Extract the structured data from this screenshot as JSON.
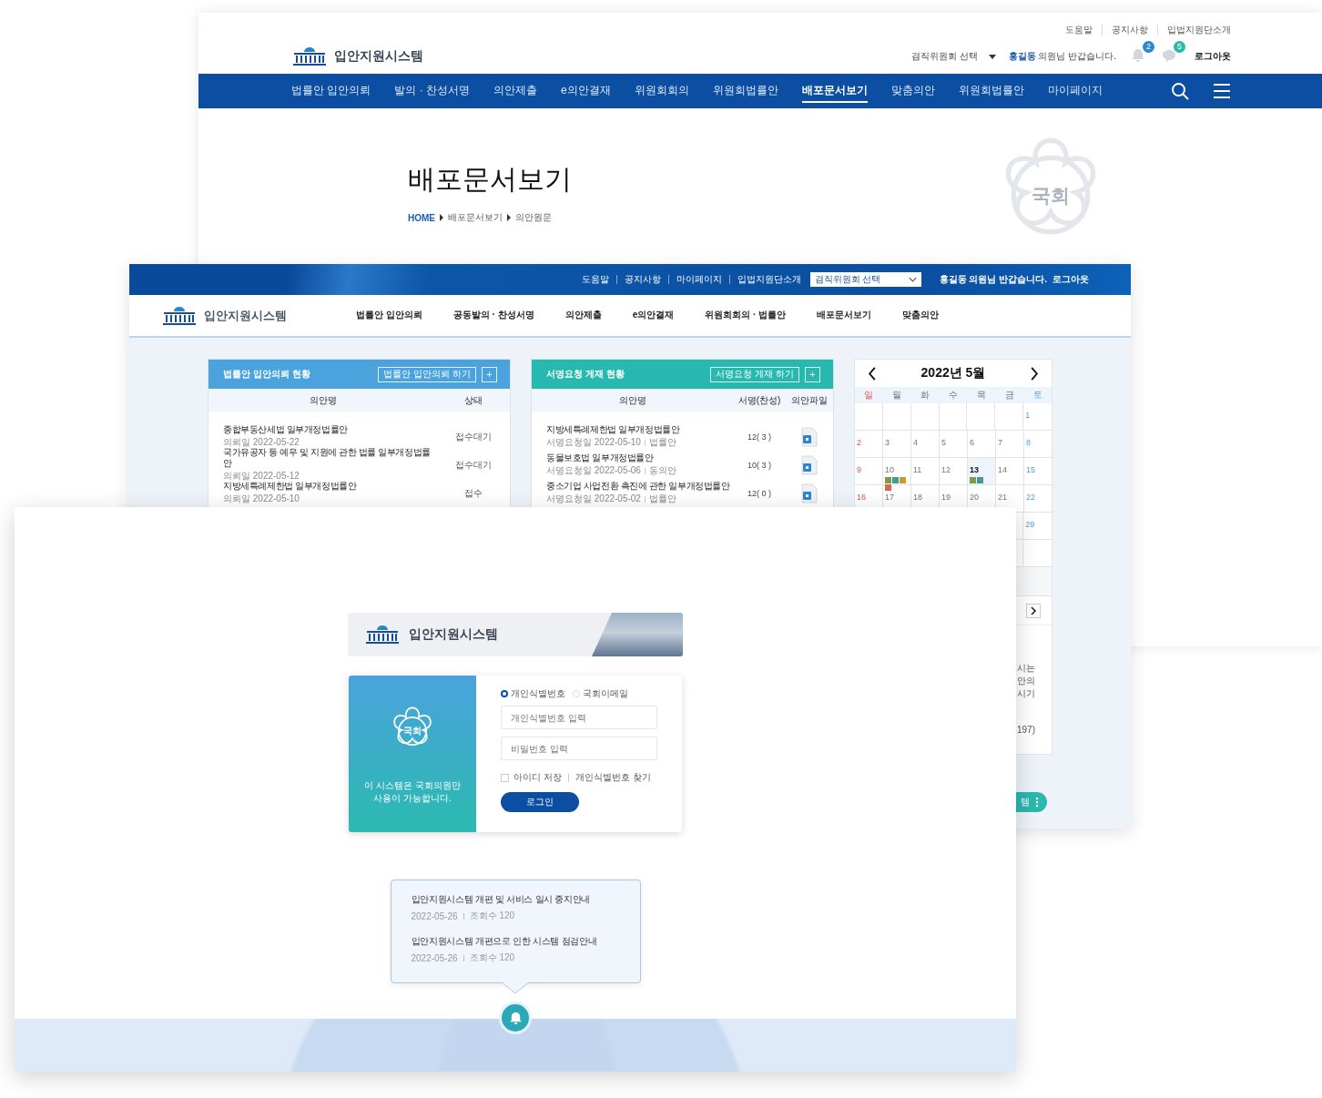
{
  "back_window": {
    "utility_links": [
      "도움말",
      "공지사항",
      "입법지원단소개"
    ],
    "logo_text": "입안지원시스템",
    "committee_select": "겸직위원회 선택",
    "user_name": "홍길동",
    "greeting": "의원님 반갑습니다.",
    "notifications": [
      {
        "kind": "bell",
        "count": "2"
      },
      {
        "kind": "chat",
        "count": "5"
      }
    ],
    "logout": "로그아웃",
    "nav": [
      {
        "label": "법률안 입안의뢰",
        "selected": false
      },
      {
        "label": "발의 · 찬성서명",
        "selected": false
      },
      {
        "label": "의안제출",
        "selected": false
      },
      {
        "label": "e의안결재",
        "selected": false
      },
      {
        "label": "위원회회의",
        "selected": false
      },
      {
        "label": "위원회법률안",
        "selected": false
      },
      {
        "label": "배포문서보기",
        "selected": true
      },
      {
        "label": "맞춤의안",
        "selected": false
      },
      {
        "label": "위원회법률안",
        "selected": false
      },
      {
        "label": "마이페이지",
        "selected": false
      }
    ],
    "page_title": "배포문서보기",
    "breadcrumb": [
      "HOME",
      "배포문서보기",
      "의안원문"
    ],
    "emblem_text": "국회"
  },
  "middle_window": {
    "utility_links": [
      "도움말",
      "공지사항",
      "마이페이지",
      "입법지원단소개"
    ],
    "committee_select": "겸직위원회 선택",
    "user_name": "홍길동",
    "greeting": "의원님 반갑습니다.",
    "logout": "로그아웃",
    "logo_text": "입안지원시스템",
    "nav": [
      {
        "label": "법률안 입안의뢰",
        "selected": false
      },
      {
        "label": "공동발의 · 찬성서명",
        "selected": false
      },
      {
        "label": "의안제출",
        "selected": false
      },
      {
        "label": "e의안결재",
        "selected": false
      },
      {
        "label": "위원회회의 · 법률안",
        "selected": false
      },
      {
        "label": "배포문서보기",
        "selected": false
      },
      {
        "label": "맞춤의안",
        "selected": false
      }
    ],
    "panels": [
      {
        "kind": "request",
        "title": "법률안 입안의뢰 현황",
        "action": "법률안 입안의뢰 하기",
        "plus": "+",
        "columns": [
          "의안명",
          "상태"
        ],
        "rows": [
          {
            "title": "종합부동산세법 일부개정법률안",
            "date": "의뢰일 2022-05-22",
            "status": "접수대기"
          },
          {
            "title": "국가유공자 등 예우 및 지원에 관한 법률 일부개정법률안",
            "date": "의뢰일 2022-05-12",
            "status": "접수대기"
          },
          {
            "title": "지방세특례제한법 일부개정법률안",
            "date": "의뢰일 2022-05-10",
            "status": "접수"
          }
        ]
      },
      {
        "kind": "signature",
        "title": "서명요청 게재 현황",
        "action": "서명요청 게재 하기",
        "plus": "+",
        "columns": [
          "의안명",
          "서명(찬성)",
          "의안파일"
        ],
        "rows": [
          {
            "title": "지방세특례제한법 일부개정법률안",
            "date": "서명요청일 2022-05-10",
            "type": "법률안",
            "count": "12( 3 )"
          },
          {
            "title": "동물보호법 일부개정법률안",
            "date": "서명요청일 2022-05-06",
            "type": "동의안",
            "count": "10( 3 )"
          },
          {
            "title": "중소기업 사업전환 촉진에 관한 일부개정법률안",
            "date": "서명요청일 2022-05-02",
            "type": "법률안",
            "count": "12( 0 )"
          }
        ]
      }
    ],
    "calendar": {
      "title": "2022년 5월",
      "weekdays": [
        "일",
        "월",
        "화",
        "수",
        "목",
        "금",
        "토"
      ],
      "weeks": [
        [
          {
            "day": "1",
            "today": false
          }
        ],
        [
          {
            "day": "2",
            "today": false
          },
          {
            "day": "3",
            "today": false
          },
          {
            "day": "4",
            "today": false
          },
          {
            "day": "5",
            "today": false
          },
          {
            "day": "6",
            "today": false
          },
          {
            "day": "7",
            "today": false
          },
          {
            "day": "8",
            "today": false
          }
        ],
        [
          {
            "day": "9",
            "today": false
          },
          {
            "day": "10",
            "today": false,
            "events": [
              {
                "color": "#7d9a52"
              },
              {
                "color": "#3f9c8e"
              },
              {
                "color": "#c99a32"
              },
              {
                "color": "#d9674c"
              }
            ]
          },
          {
            "day": "11",
            "today": false
          },
          {
            "day": "12",
            "today": false
          },
          {
            "day": "13",
            "today": true,
            "events": [
              {
                "color": "#7d9a52"
              },
              {
                "color": "#3f9c8e"
              }
            ]
          },
          {
            "day": "14",
            "today": false
          },
          {
            "day": "15",
            "today": false
          }
        ],
        [
          {
            "day": "16",
            "today": false
          },
          {
            "day": "17",
            "today": false
          },
          {
            "day": "18",
            "today": false
          },
          {
            "day": "19",
            "today": false
          },
          {
            "day": "20",
            "today": false
          },
          {
            "day": "21",
            "today": false
          },
          {
            "day": "22",
            "today": false
          }
        ],
        [
          {
            "day": "29",
            "today": false
          }
        ]
      ],
      "text_fragments": [
        "시는",
        "안의",
        "시기"
      ],
      "count_fragment": "197)"
    },
    "floating_button": "템"
  },
  "front_window": {
    "logo_text": "입안지원시스템",
    "emblem_text": "국회",
    "caption": [
      "이 시스템은 국회의원만",
      "사용이 가능합니다."
    ],
    "login_types": [
      {
        "label": "개인식별번호",
        "selected": true
      },
      {
        "label": "국회이메일",
        "selected": false
      }
    ],
    "id_placeholder": "개인식별번호 입력",
    "password_placeholder": "비밀번호 입력",
    "remember": {
      "label": "아이디 저장",
      "checked": false
    },
    "find_link": "개인식별번호 찾기",
    "login_button": "로그인",
    "notices": [
      {
        "title": "입안지원시스템 개편 및 서비스 일시 중지안내",
        "date": "2022-05-26",
        "views": "조회수 120"
      },
      {
        "title": "입안지원시스템 개편으로 인한 시스템 점검안내",
        "date": "2022-05-26",
        "views": "조회수 120"
      }
    ]
  }
}
